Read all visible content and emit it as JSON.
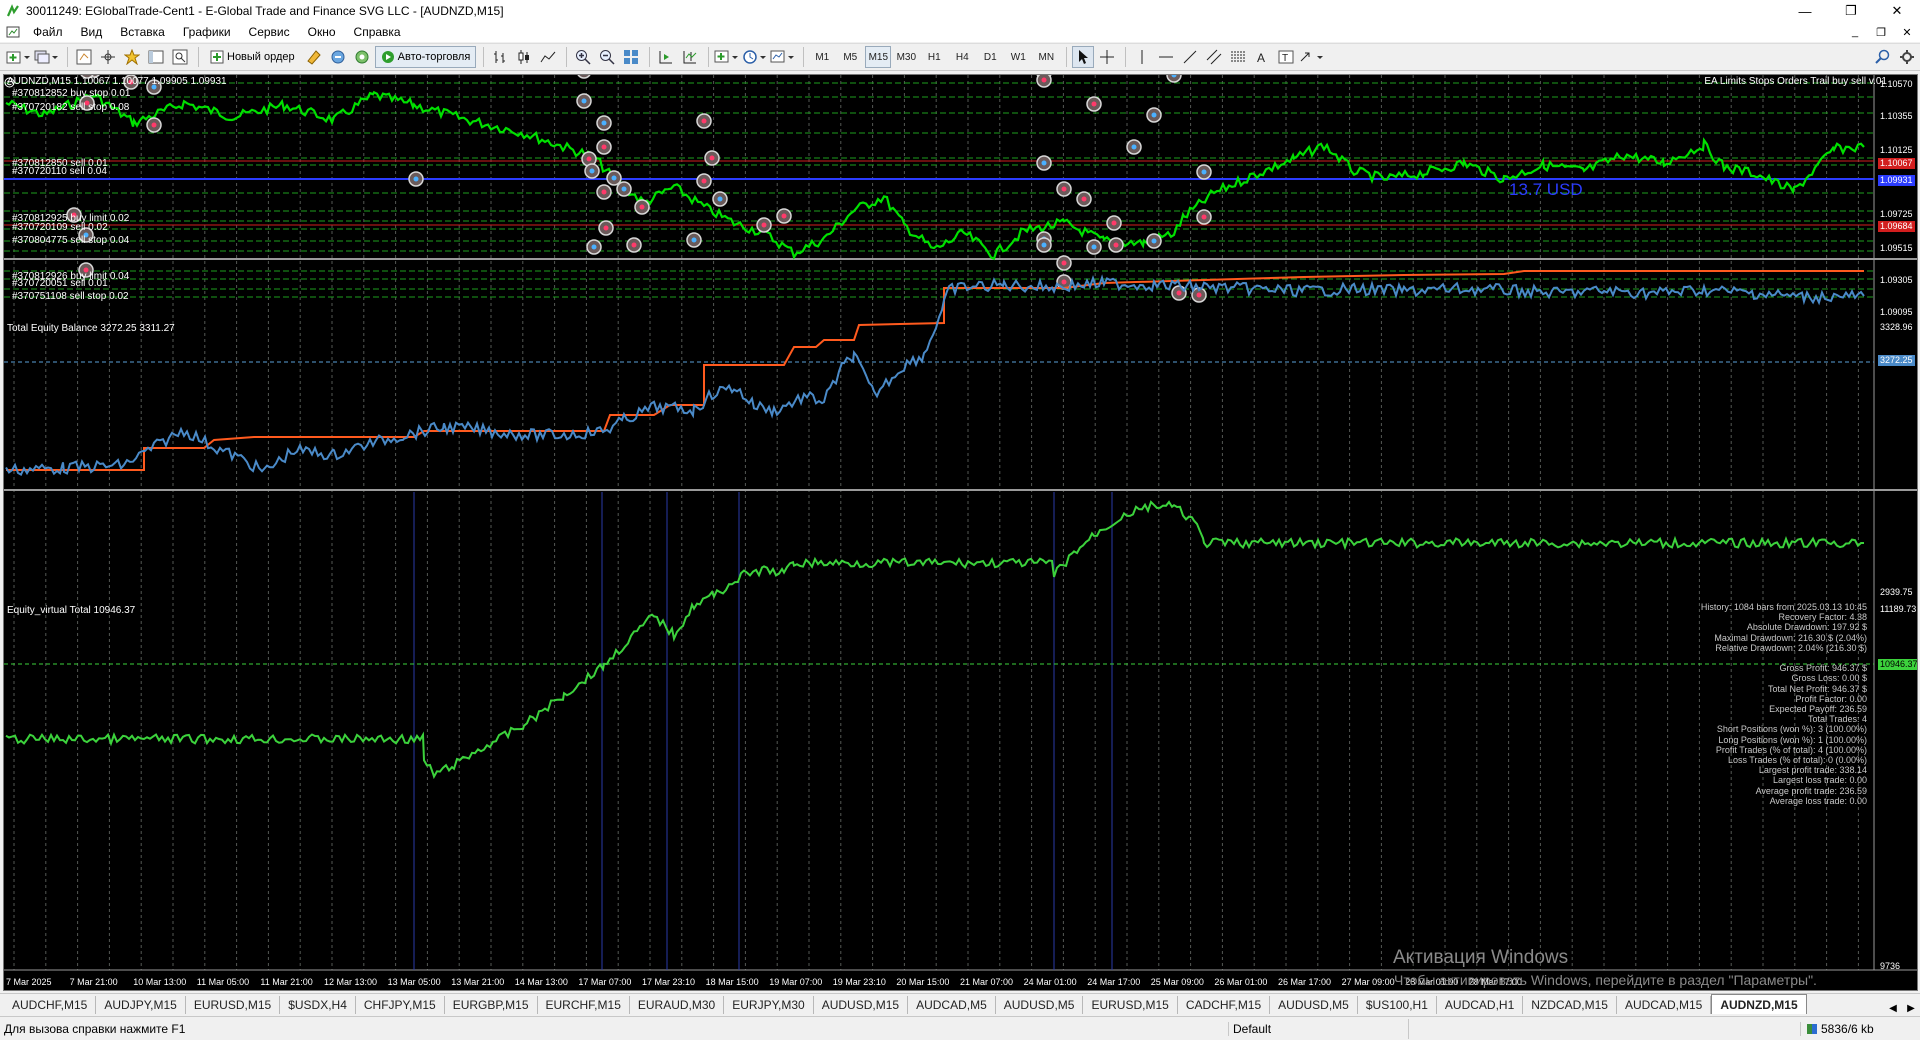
{
  "window": {
    "title": "30011249: EGlobalTrade-Cent1 - E-Global Trade and Finance SVG LLC - [AUDNZD,M15]",
    "min": "—",
    "max": "❐",
    "close": "✕"
  },
  "menu": [
    "Файл",
    "Вид",
    "Вставка",
    "Графики",
    "Сервис",
    "Окно",
    "Справка"
  ],
  "mdi_controls": [
    "_",
    "❐",
    "✕"
  ],
  "toolbar": {
    "new_order": "Новый ордер",
    "autotrading": "Авто-торговля",
    "timeframes": [
      "M1",
      "M5",
      "M15",
      "M30",
      "H1",
      "H4",
      "D1",
      "W1",
      "MN"
    ],
    "active_timeframe": "M15"
  },
  "chart": {
    "header": "AUDNZD,M15  1.10067 1.10077 1.09905 1.09931",
    "ea_label": "EA Limits Stops Orders Trail buy sell v.01",
    "profit_label": "13.7 USD",
    "order_labels": [
      "#370812852 buy stop 0.01",
      "#370720182 sell stop 0.08",
      "#370812850 sell 0.01",
      "#370720110 sell 0.04",
      "#370812925 buy limit 0.02",
      "#370720109 sell 0.02",
      "#370804775 sell stop 0.04",
      "#370812926 buy limit 0.04",
      "#370720051 sell 0.01",
      "#370751108 sell stop 0.02"
    ],
    "price_axis": [
      "1.10570",
      "1.10355",
      "1.10125",
      "1.09725",
      "1.09515",
      "1.09305",
      "1.09095"
    ],
    "price_tags": [
      "1.10067",
      "1.09931",
      "1.09684"
    ],
    "equity_header": "Total Equity Balance 3272.25 3311.27",
    "equity_axis_top": "3328.96",
    "equity_axis_bottom": "2939.75",
    "equity_tag": "3272.25",
    "virtual_header": "Equity_virtual Total 10946.37",
    "virtual_axis_top": "11189.73",
    "virtual_axis_bottom": "9736",
    "virtual_tag": "10946.37",
    "time_axis": [
      "7 Mar 2025",
      "7 Mar 21:00",
      "10 Mar 13:00",
      "11 Mar 05:00",
      "11 Mar 21:00",
      "12 Mar 13:00",
      "13 Mar 05:00",
      "13 Mar 21:00",
      "14 Mar 13:00",
      "17 Mar 07:00",
      "17 Mar 23:10",
      "18 Mar 15:00",
      "19 Mar 07:00",
      "19 Mar 23:10",
      "20 Mar 15:00",
      "21 Mar 07:00",
      "24 Mar 01:00",
      "24 Mar 17:00",
      "25 Mar 09:00",
      "26 Mar 01:00",
      "26 Mar 17:00",
      "27 Mar 09:00",
      "28 Mar 01:00",
      "28 Mar 17:00"
    ],
    "stats": [
      "History: 1084 bars from 2025.03.13 10:45",
      "Recovery Factor: 4.38",
      "Absolute Drawdown: 197.92 $",
      "Maximal Drawdown: 216.30 $ (2.04%)",
      "Relative Drawdown: 2.04% (216.30 $)",
      "",
      "Gross Profit: 946.37 $",
      "Gross Loss: 0.00 $",
      "Total Net Profit: 946.37 $",
      "Profit Factor: 0.00",
      "Expected Payoff: 236.59",
      "Total Trades: 4",
      "Short Positions (won %): 3 (100.00%)",
      "Long Positions (won %): 1 (100.00%)",
      "Profit Trades (% of total): 4 (100.00%)",
      "Loss Trades (% of total): 0 (0.00%)",
      "Largest profit trade: 338.14",
      "Largest loss trade: 0.00",
      "Average profit trade: 236.59",
      "Average loss trade: 0.00"
    ],
    "watermark_title": "Активация Windows",
    "watermark_text": "Чтобы активировать Windows, перейдите в раздел \"Параметры\"."
  },
  "tabs": [
    "AUDCHF,M15",
    "AUDJPY,M15",
    "EURUSD,M15",
    "$USDX,H4",
    "CHFJPY,M15",
    "EURGBP,M15",
    "EURCHF,M15",
    "EURAUD,M30",
    "EURJPY,M30",
    "AUDUSD,M15",
    "AUDCAD,M5",
    "AUDUSD,M5",
    "EURUSD,M15",
    "CADCHF,M15",
    "AUDUSD,M5",
    "$US100,H1",
    "AUDCAD,H1",
    "NZDCAD,M15",
    "AUDCAD,M15",
    "AUDNZD,M15"
  ],
  "active_tab": "AUDNZD,M15",
  "status": {
    "help": "Для вызова справки нажмите F1",
    "profile": "Default",
    "traffic": "5836/6 kb"
  },
  "colors": {
    "price_line": "#00e000",
    "equity_line": "#4a8ac8",
    "balance_line": "#ff5a1e",
    "virtual_line": "#3cd23c",
    "bid_line": "#2b3cff",
    "order_line_red": "#d21e1e",
    "grid": "#9aa09a"
  }
}
